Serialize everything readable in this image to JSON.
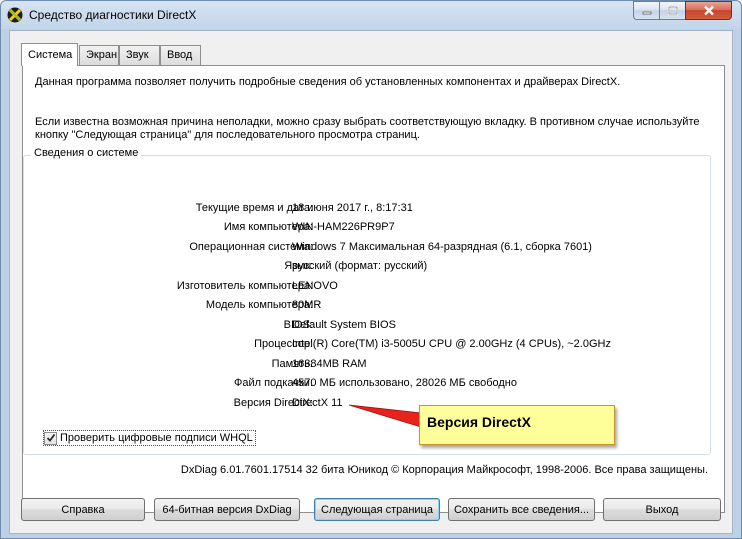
{
  "window": {
    "title": "Средство диагностики DirectX"
  },
  "tabs": [
    {
      "label": "Система",
      "active": true
    },
    {
      "label": "Экран",
      "active": false
    },
    {
      "label": "Звук",
      "active": false
    },
    {
      "label": "Ввод",
      "active": false
    }
  ],
  "intro": {
    "line1": "Данная программа позволяет получить подробные сведения об установленных компонентах и драйверах DirectX.",
    "line2": "Если известна возможная причина неполадки, можно сразу выбрать соответствующую вкладку. В противном случае используйте",
    "line3": "кнопку \"Следующая страница\" для последовательного просмотра страниц."
  },
  "system_info": {
    "title": "Сведения о системе",
    "rows": [
      {
        "label": "Текущие время и дата:",
        "value": "18 июня 2017 г., 8:17:31"
      },
      {
        "label": "Имя компьютера:",
        "value": "WIN-HAM226PR9P7"
      },
      {
        "label": "Операционная система:",
        "value": "Windows 7 Максимальная 64-разрядная (6.1, сборка 7601)"
      },
      {
        "label": "Язык:",
        "value": "русский (формат: русский)"
      },
      {
        "label": "Изготовитель компьютера:",
        "value": "LENOVO"
      },
      {
        "label": "Модель компьютера:",
        "value": "80MR"
      },
      {
        "label": "BIOS:",
        "value": "Default System BIOS"
      },
      {
        "label": "Процессор:",
        "value": "Intel(R) Core(TM) i3-5005U CPU @ 2.00GHz (4 CPUs), ~2.0GHz"
      },
      {
        "label": "Память:",
        "value": "16384MB RAM"
      },
      {
        "label": "Файл подкачки:",
        "value": "4570 МБ использовано, 28026 МБ свободно"
      },
      {
        "label": "Версия DirectX:",
        "value": "DirectX 11"
      }
    ]
  },
  "whql_checkbox": {
    "label": "Проверить цифровые подписи WHQL",
    "checked": true
  },
  "footer": {
    "text": "DxDiag 6.01.7601.17514 32 бита Юникод  © Корпорация Майкрософт, 1998-2006.  Все права защищены."
  },
  "buttons": {
    "help": "Справка",
    "dxdiag64": "64-битная версия DxDiag",
    "next_page": "Следующая страница",
    "save_all": "Сохранить все сведения...",
    "exit": "Выход"
  },
  "callout": {
    "text": "Версия DirectX"
  },
  "colors": {
    "callout_bg": "#ffff99",
    "callout_arrow": "#e8221c",
    "close_button": "#c4452c"
  }
}
